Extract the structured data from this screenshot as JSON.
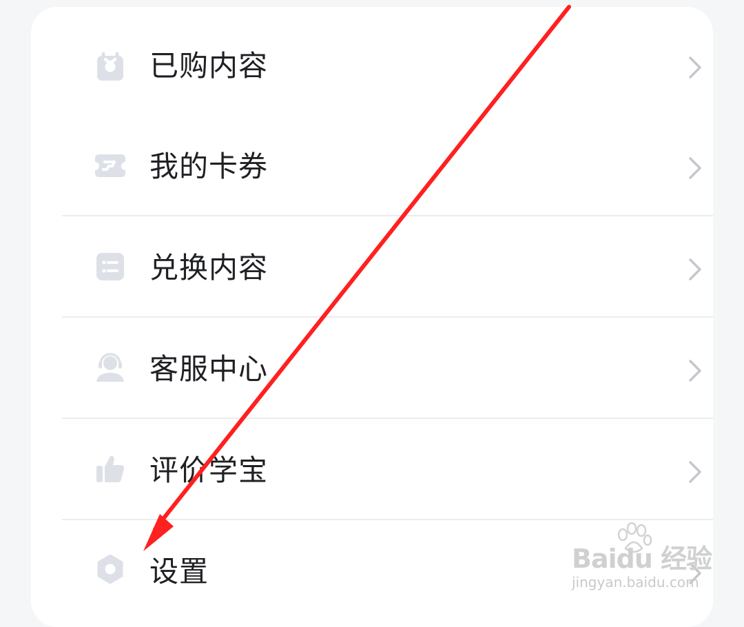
{
  "menu": {
    "items": [
      {
        "label": "已购内容",
        "icon": "purchased-bag-icon"
      },
      {
        "label": "我的卡券",
        "icon": "ticket-icon"
      },
      {
        "label": "兑换内容",
        "icon": "list-card-icon"
      },
      {
        "label": "客服中心",
        "icon": "headset-agent-icon"
      },
      {
        "label": "评价学宝",
        "icon": "thumbs-up-icon"
      },
      {
        "label": "设置",
        "icon": "settings-hexagon-icon"
      }
    ]
  },
  "watermark": {
    "text": "jingyan.baidu.com",
    "brand": "Baidu 经验"
  },
  "colors": {
    "icon_gray": "#dde1e7",
    "chevron_gray": "#c4c7cc",
    "arrow_red": "#ff2020",
    "separator": "#ececef"
  }
}
